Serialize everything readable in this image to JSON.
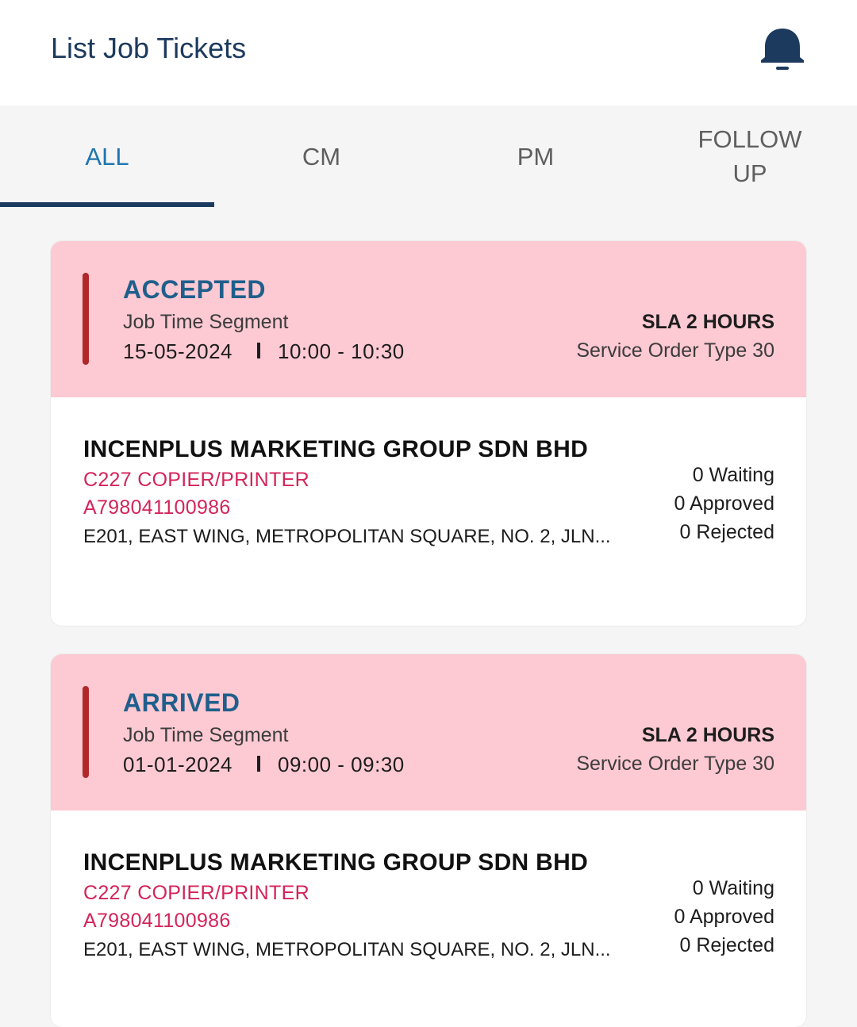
{
  "header": {
    "title": "List Job Tickets",
    "notification_icon": "bell-icon"
  },
  "tabs": [
    {
      "label": "ALL",
      "active": true
    },
    {
      "label": "CM",
      "active": false
    },
    {
      "label": "PM",
      "active": false
    },
    {
      "label": "FOLLOW UP",
      "active": false
    }
  ],
  "colors": {
    "brand": "#1c3a5e",
    "active_tab": "#1f75b0",
    "card_header": "#fdc9d3",
    "accent_bar": "#b0282c",
    "product_text": "#d4245a"
  },
  "tickets": [
    {
      "status": "ACCEPTED",
      "segment_label": "Job Time Segment",
      "date": "15-05-2024",
      "time": "10:00 - 10:30",
      "sla": "SLA 2 HOURS",
      "service_order_type": "Service Order Type 30",
      "company": "INCENPLUS MARKETING GROUP SDN BHD",
      "product": "C227 COPIER/PRINTER",
      "serial": "A798041100986",
      "address": "E201, EAST WING, METROPOLITAN SQUARE, NO. 2, JLN...",
      "waiting": "0 Waiting",
      "approved": "0 Approved",
      "rejected": "0 Rejected"
    },
    {
      "status": "ARRIVED",
      "segment_label": "Job Time Segment",
      "date": "01-01-2024",
      "time": "09:00 - 09:30",
      "sla": "SLA 2 HOURS",
      "service_order_type": "Service Order Type 30",
      "company": "INCENPLUS MARKETING GROUP SDN BHD",
      "product": "C227 COPIER/PRINTER",
      "serial": "A798041100986",
      "address": "E201, EAST WING, METROPOLITAN SQUARE, NO. 2, JLN...",
      "waiting": "0 Waiting",
      "approved": "0 Approved",
      "rejected": "0 Rejected"
    }
  ]
}
